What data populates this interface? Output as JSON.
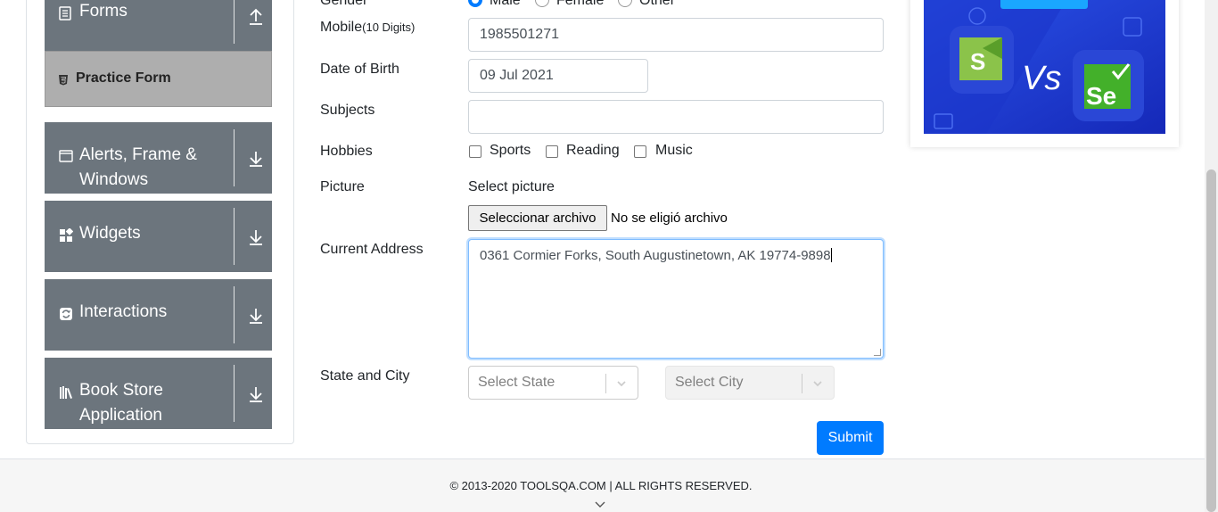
{
  "sidebar": {
    "groups": [
      {
        "title": "Forms",
        "icon": "document-icon",
        "expanded": true
      },
      {
        "title_line1": "Alerts, Frame &",
        "title_line2": "Windows",
        "icon": "window-icon"
      },
      {
        "title": "Widgets",
        "icon": "widgets-icon"
      },
      {
        "title": "Interactions",
        "icon": "interactions-icon"
      },
      {
        "title_line1": "Book Store",
        "title_line2": "Application",
        "icon": "books-icon"
      }
    ],
    "active_item": "Practice Form"
  },
  "form": {
    "gender": {
      "label": "Gender",
      "options": [
        "Male",
        "Female",
        "Other"
      ],
      "selected": "Male"
    },
    "mobile": {
      "label": "Mobile",
      "hint": "(10 Digits)",
      "value": "1985501271"
    },
    "dob": {
      "label": "Date of Birth",
      "value": "09 Jul 2021"
    },
    "subjects": {
      "label": "Subjects",
      "value": ""
    },
    "hobbies": {
      "label": "Hobbies",
      "options": [
        "Sports",
        "Reading",
        "Music"
      ]
    },
    "picture": {
      "label": "Picture",
      "caption": "Select picture",
      "button": "Seleccionar archivo",
      "status": "No se eligió archivo"
    },
    "address": {
      "label": "Current Address",
      "value": "0361 Cormier Forks, South Augustinetown, AK 19774-9898"
    },
    "state_city": {
      "label": "State and City",
      "state_placeholder": "Select State",
      "city_placeholder": "Select City"
    },
    "submit": "Submit"
  },
  "ad": {
    "vs_text": "Vs",
    "logo_right": "Se",
    "logo_left": "S"
  },
  "footer": {
    "copyright": "© 2013-2020 TOOLSQA.COM | ALL RIGHTS RESERVED."
  },
  "colors": {
    "primary": "#007bff",
    "sidebar": "#6c757d",
    "active": "#aeaeae",
    "ad_bg": "#1e3ad9"
  }
}
